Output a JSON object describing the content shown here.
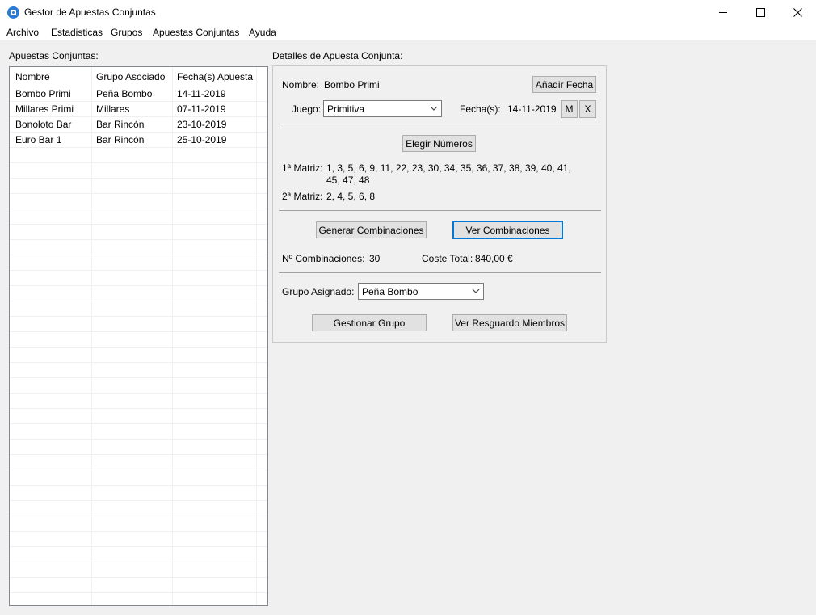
{
  "window": {
    "title": "Gestor de Apuestas Conjuntas",
    "icon": "dice-icon"
  },
  "menu": [
    "Archivo",
    "Estadisticas",
    "Grupos",
    "Apuestas Conjuntas",
    "Ayuda"
  ],
  "list": {
    "title": "Apuestas Conjuntas:",
    "columns": [
      "Nombre",
      "Grupo Asociado",
      "Fecha(s) Apuesta"
    ],
    "rows": [
      [
        "Bombo Primi",
        "Peña Bombo",
        "14-11-2019"
      ],
      [
        "Millares Primi",
        "Millares",
        "07-11-2019"
      ],
      [
        "Bonoloto Bar",
        "Bar Rincón",
        "23-10-2019"
      ],
      [
        "Euro Bar 1",
        "Bar Rincón",
        "25-10-2019"
      ]
    ]
  },
  "details": {
    "title": "Detalles de Apuesta Conjunta:",
    "nombre_label": "Nombre:",
    "nombre_value": "Bombo Primi",
    "add_date_button": "Añadir Fecha",
    "juego_label": "Juego:",
    "juego_value": "Primitiva",
    "fechas_label": "Fecha(s):",
    "fechas_value": "14-11-2019",
    "m_button": "M",
    "x_button": "X",
    "choose_numbers_button": "Elegir Números",
    "matriz1_label": "1ª Matriz:",
    "matriz1_line1": "1, 3, 5, 6, 9, 11, 22, 23, 30, 34, 35, 36, 37, 38, 39, 40, 41,",
    "matriz1_line2": "45, 47, 48",
    "matriz2_label": "2ª Matriz:",
    "matriz2_value": "2, 4, 5, 6, 8",
    "generate_button": "Generar Combinaciones",
    "view_button": "Ver Combinaciones",
    "combinaciones_label": "Nº Combinaciones:",
    "combinaciones_value": "30",
    "coste_label": "Coste Total:",
    "coste_value": "840,00 €",
    "grupo_label": "Grupo Asignado:",
    "grupo_value": "Peña Bombo",
    "manage_group_button": "Gestionar Grupo",
    "members_button": "Ver Resguardo Miembros"
  }
}
